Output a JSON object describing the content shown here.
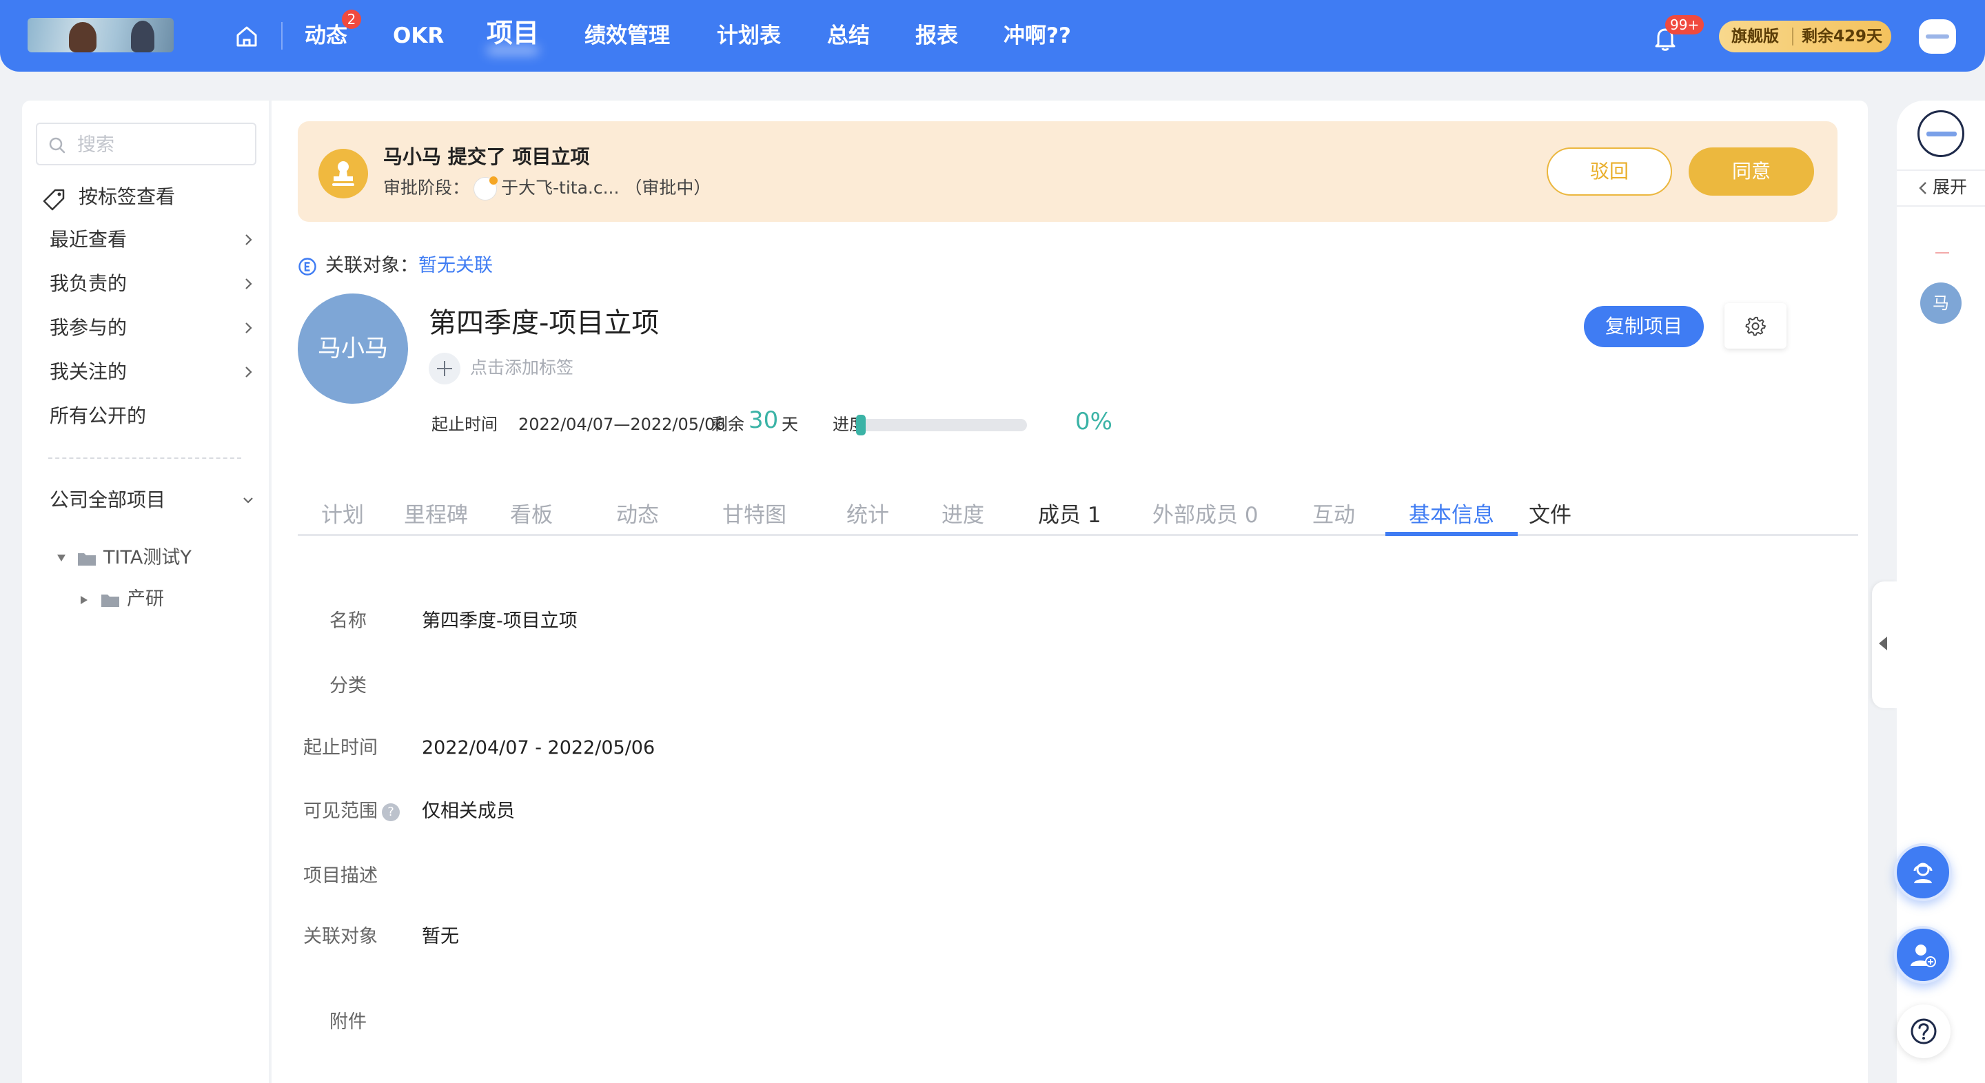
{
  "topnav": {
    "items": [
      {
        "label": "动态",
        "badge": "2"
      },
      {
        "label": "OKR"
      },
      {
        "label": "项目",
        "active": true
      },
      {
        "label": "绩效管理"
      },
      {
        "label": "计划表"
      },
      {
        "label": "总结"
      },
      {
        "label": "报表"
      },
      {
        "label": "冲啊??"
      }
    ],
    "notification_badge": "99+",
    "plan_edition": "旗舰版",
    "plan_remaining": "剩余429天",
    "icons": {
      "home": "home-icon",
      "bell": "bell-icon"
    }
  },
  "sidebar": {
    "search_placeholder": "搜索",
    "tag_view": "按标签查看",
    "items": [
      {
        "label": "最近查看"
      },
      {
        "label": "我负责的"
      },
      {
        "label": "我参与的"
      },
      {
        "label": "我关注的"
      },
      {
        "label": "所有公开的"
      }
    ],
    "group_label": "公司全部项目",
    "tree": [
      {
        "label": "TITA测试Y"
      },
      {
        "label": "产研"
      }
    ]
  },
  "approval": {
    "title": "马小马 提交了 项目立项",
    "stage_label": "审批阶段：",
    "stage_value": "于大飞-tita.c... （审批中）",
    "reject_label": "驳回",
    "agree_label": "同意"
  },
  "project": {
    "assoc_label": "关联对象：",
    "assoc_value": "暂无关联",
    "owner_avatar_text": "马小马",
    "title": "第四季度-项目立项",
    "add_tag_label": "点击添加标签",
    "period_label": "起止时间",
    "period_value": "2022/04/07—2022/05/06",
    "remaining_label": "剩余",
    "remaining_days": "30",
    "remaining_unit": "天",
    "progress_label": "进度",
    "progress_value": "0%",
    "progress_fraction": 0,
    "copy_button": "复制项目"
  },
  "tabs": [
    {
      "label": "计划"
    },
    {
      "label": "里程碑"
    },
    {
      "label": "看板"
    },
    {
      "label": "动态"
    },
    {
      "label": "甘特图"
    },
    {
      "label": "统计"
    },
    {
      "label": "进度"
    },
    {
      "label": "成员 1"
    },
    {
      "label": "外部成员 0"
    },
    {
      "label": "互动"
    },
    {
      "label": "基本信息",
      "active": true
    },
    {
      "label": "文件"
    }
  ],
  "basic_info": {
    "name_label": "名称",
    "name_value": "第四季度-项目立项",
    "category_label": "分类",
    "period_label": "起止时间",
    "period_value": "2022/04/07 - 2022/05/06",
    "visibility_label": "可见范围",
    "visibility_help": "?",
    "visibility_value": "仅相关成员",
    "description_label": "项目描述",
    "related_label": "关联对象",
    "related_value": "暂无",
    "attachment_label": "附件"
  },
  "right_rail": {
    "expand_label": "展开",
    "member_avatar_text": "马",
    "help_icon": "question-icon"
  },
  "colors": {
    "brand_blue": "#3f7cf3",
    "approval_yellow": "#ecb83e",
    "progress_teal": "#3bb3a6",
    "badge_red": "#f04a3e"
  }
}
